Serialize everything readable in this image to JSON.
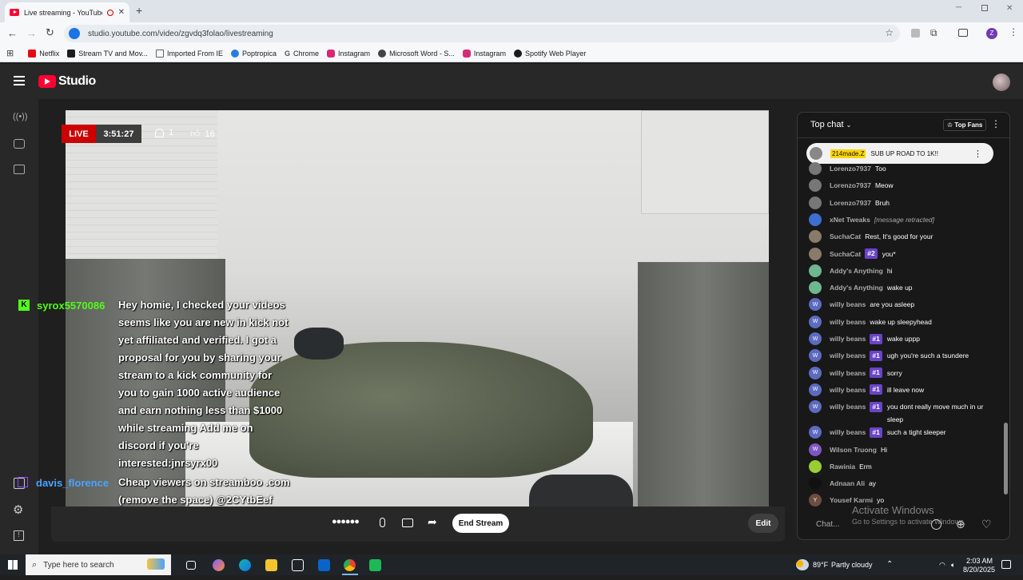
{
  "browser": {
    "tab_title": "Live streaming - YouTube S",
    "new_tab": "+",
    "url": "studio.youtube.com/video/zgvdq3folao/livestreaming",
    "bookmarks": [
      {
        "label": "Netflix",
        "color": "#e50914"
      },
      {
        "label": "Stream TV and Mov...",
        "color": "#1c1c1c"
      },
      {
        "label": "Imported From IE",
        "color": "#5f6368"
      },
      {
        "label": "Poptropica",
        "color": "#2a7de1"
      },
      {
        "label": "Chrome",
        "color": "#5f6368"
      },
      {
        "label": "Instagram",
        "color": "#d62976"
      },
      {
        "label": "Microsoft Word - S...",
        "color": "#444"
      },
      {
        "label": "Instagram",
        "color": "#d62976"
      },
      {
        "label": "Spotify Web Player",
        "color": "#1c1c1c"
      }
    ],
    "profile_initial": "Z"
  },
  "studio": {
    "logo_text": "Studio",
    "live": {
      "badge": "LIVE",
      "elapsed": "3:51:27",
      "viewers": "1",
      "likes": "16"
    },
    "overlay_chat": [
      {
        "name": "syrox5570086",
        "name_color": "#53fc18",
        "message": "Hey homie, I checked your videos seems like you are new in kick not yet affiliated and verified. I got a proposal for you by sharing your stream to a kick community for you to gain 1000 active audience and earn nothing less than $1000 while streaming Add me on discord if you're interested:jnrsyrx00"
      },
      {
        "name": "davis_florence",
        "name_color": "#4aa3ff",
        "message": "Cheap viewers on streamboo .com (remove the space) @2CYtbEef"
      }
    ],
    "controls": {
      "end_stream": "End Stream",
      "edit": "Edit"
    }
  },
  "chat": {
    "header": "Top chat",
    "top_fans": "Top Fans",
    "pinned": {
      "user": "214made.Z",
      "message": "SUB UP ROAD TO 1K!!"
    },
    "messages": [
      {
        "user": "Lorenzo7937",
        "text": "Too",
        "avatar_color": "#777",
        "initial": ""
      },
      {
        "user": "Lorenzo7937",
        "text": "Meow",
        "avatar_color": "#777",
        "initial": ""
      },
      {
        "user": "Lorenzo7937",
        "text": "Bruh",
        "avatar_color": "#777",
        "initial": ""
      },
      {
        "user": "xNet Tweaks",
        "text": "[message retracted]",
        "avatar_color": "#3d6fd1",
        "initial": "",
        "retracted": true
      },
      {
        "user": "SuchaCat",
        "text": "Rest, It's good for your",
        "avatar_color": "#8a7a6a",
        "initial": ""
      },
      {
        "user": "SuchaCat",
        "rank": "#2",
        "text": "you*",
        "avatar_color": "#8a7a6a",
        "initial": ""
      },
      {
        "user": "Addy's Anything",
        "text": "hi",
        "avatar_color": "#6fb88f",
        "initial": ""
      },
      {
        "user": "Addy's Anything",
        "text": "wake up",
        "avatar_color": "#6fb88f",
        "initial": ""
      },
      {
        "user": "willy beans",
        "text": "are you asleep",
        "avatar_color": "#5c6bc0",
        "initial": "W"
      },
      {
        "user": "willy beans",
        "text": "wake up sleepyhead",
        "avatar_color": "#5c6bc0",
        "initial": "W"
      },
      {
        "user": "willy beans",
        "rank": "#1",
        "text": "wake uppp",
        "avatar_color": "#5c6bc0",
        "initial": "W"
      },
      {
        "user": "willy beans",
        "rank": "#1",
        "text": "ugh you're such a tsundere",
        "avatar_color": "#5c6bc0",
        "initial": "W"
      },
      {
        "user": "willy beans",
        "rank": "#1",
        "text": "sorry",
        "avatar_color": "#5c6bc0",
        "initial": "W"
      },
      {
        "user": "willy beans",
        "rank": "#1",
        "text": "ill leave now",
        "avatar_color": "#5c6bc0",
        "initial": "W"
      },
      {
        "user": "willy beans",
        "rank": "#1",
        "text": "you dont really move much in ur sleep",
        "avatar_color": "#5c6bc0",
        "initial": "W"
      },
      {
        "user": "willy beans",
        "rank": "#1",
        "text": "such a tight sleeper",
        "avatar_color": "#5c6bc0",
        "initial": "W"
      },
      {
        "user": "Wilson Truong",
        "text": "Hi",
        "avatar_color": "#7e57c2",
        "initial": "W"
      },
      {
        "user": "Rawinia",
        "text": "Erm",
        "avatar_color": "#9acd32",
        "initial": ""
      },
      {
        "user": "Adnaan Ali",
        "text": "ay",
        "avatar_color": "#111",
        "initial": ""
      },
      {
        "user": "Yousef Karmi",
        "text": "yo",
        "avatar_color": "#6d4c41",
        "initial": "Y"
      }
    ],
    "input_placeholder": "Chat..."
  },
  "watermark": {
    "title": "Activate Windows",
    "subtitle": "Go to Settings to activate Windows."
  },
  "taskbar": {
    "search_placeholder": "Type here to search",
    "weather_temp": "89°F",
    "weather_desc": "Partly cloudy",
    "time": "2:03 AM",
    "date": "8/20/2025"
  }
}
